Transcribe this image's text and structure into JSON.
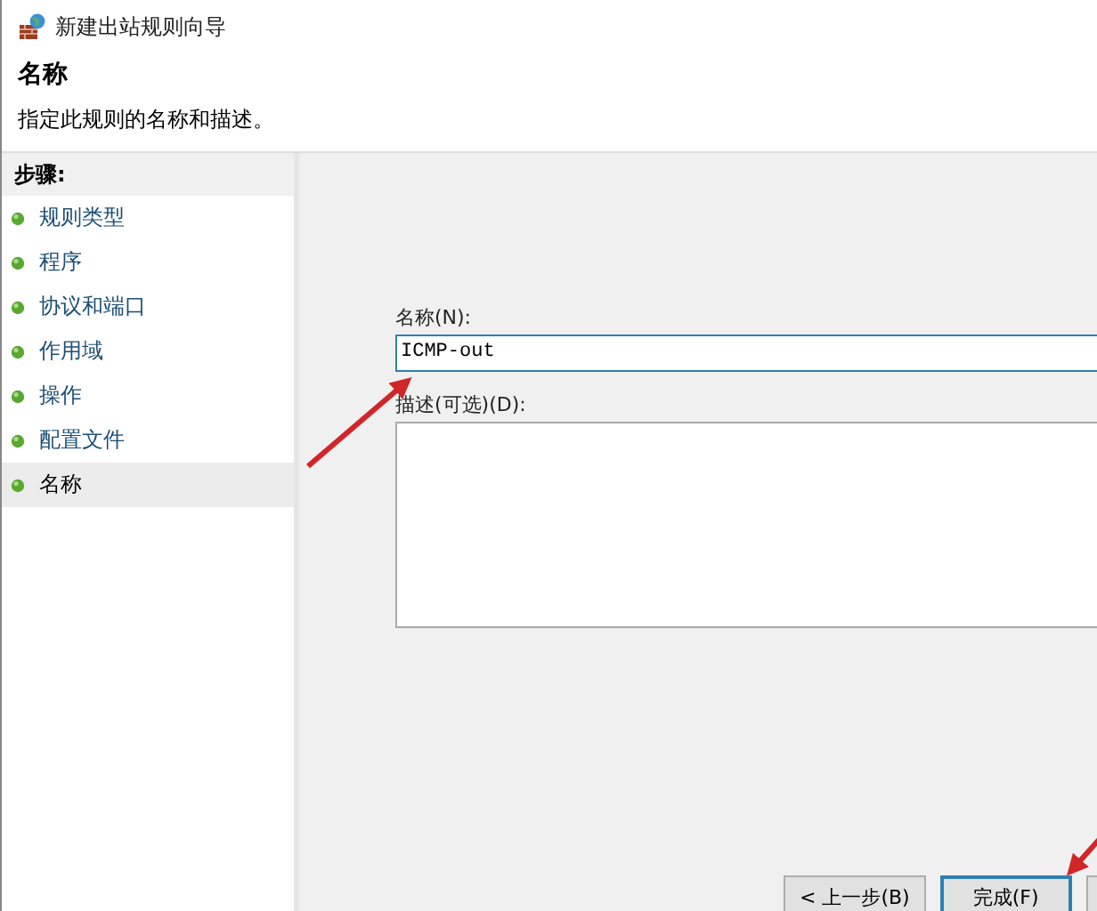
{
  "window": {
    "title": "新建出站规则向导"
  },
  "header": {
    "title": "名称",
    "subtitle": "指定此规则的名称和描述。"
  },
  "steps": {
    "heading": "步骤:",
    "items": [
      {
        "label": "规则类型",
        "selected": false
      },
      {
        "label": "程序",
        "selected": false
      },
      {
        "label": "协议和端口",
        "selected": false
      },
      {
        "label": "作用域",
        "selected": false
      },
      {
        "label": "操作",
        "selected": false
      },
      {
        "label": "配置文件",
        "selected": false
      },
      {
        "label": "名称",
        "selected": true
      }
    ]
  },
  "form": {
    "name_label": "名称(N):",
    "name_value": "ICMP-out",
    "description_label": "描述(可选)(D):"
  },
  "buttons": [
    {
      "label": "< 上一步(B)",
      "kind": "normal"
    },
    {
      "label": "完成(F)",
      "kind": "default"
    },
    {
      "kind": "cut"
    }
  ]
}
